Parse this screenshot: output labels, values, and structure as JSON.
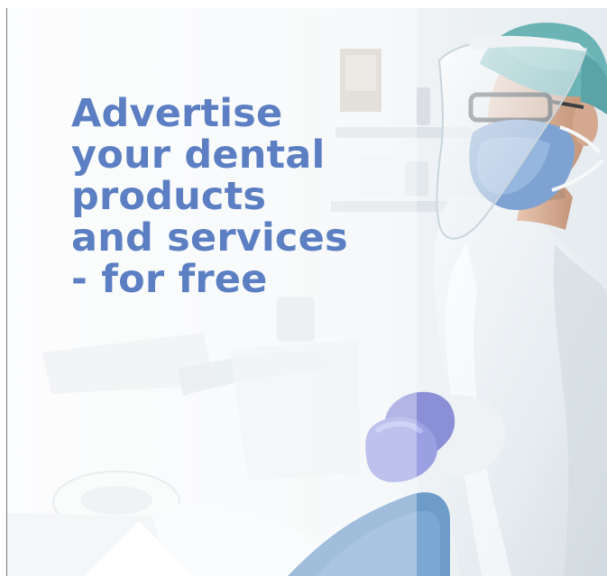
{
  "ad": {
    "headline_lines": [
      "Advertise",
      "your dental",
      "products",
      "and services",
      "- for free"
    ]
  },
  "colors": {
    "headline": "#5b7fc2",
    "scrub_white": "#e9eef2",
    "glove": "#8a8fd6",
    "cap": "#6bb3b5",
    "chair_blue": "#6d9cc9"
  }
}
